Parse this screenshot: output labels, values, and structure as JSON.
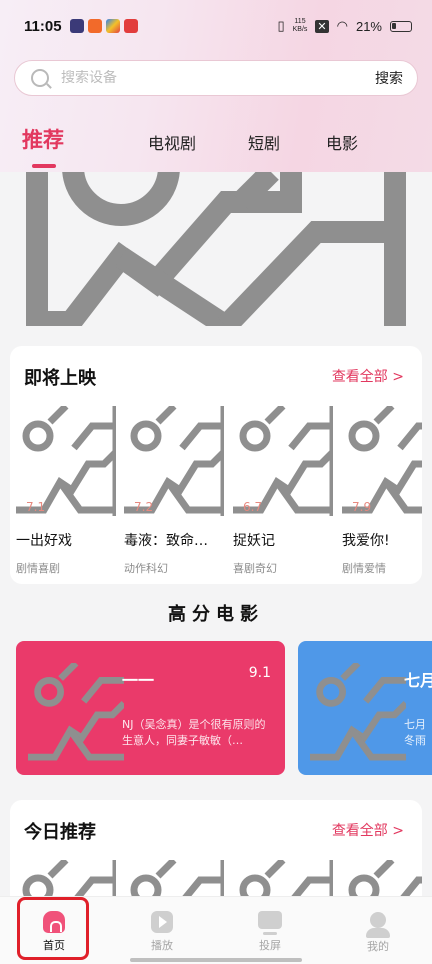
{
  "status_bar": {
    "time": "11:05",
    "net_speed_value": "115",
    "net_speed_unit": "KB/s",
    "battery": "21%"
  },
  "search": {
    "placeholder": "搜索设备",
    "button": "搜索"
  },
  "tabs": [
    {
      "label": "推荐",
      "active": true
    },
    {
      "label": "电视剧",
      "active": false
    },
    {
      "label": "短剧",
      "active": false
    },
    {
      "label": "电影",
      "active": false
    }
  ],
  "upcoming": {
    "title": "即将上映",
    "see_all": "查看全部 >",
    "items": [
      {
        "name": "一出好戏",
        "rating": "7.1",
        "genre": "剧情喜剧"
      },
      {
        "name": "毒液：致命…",
        "rating": "7.2",
        "genre": "动作科幻"
      },
      {
        "name": "捉妖记",
        "rating": "6.7",
        "genre": "喜剧奇幻"
      },
      {
        "name": "我爱你!",
        "rating": "7.9",
        "genre": "剧情爱情"
      }
    ]
  },
  "high_score": {
    "title": "高分电影",
    "cards": [
      {
        "name": "一一",
        "score": "9.1",
        "desc": "NJ（吴念真）是个很有原则的生意人，同妻子敏敏（…"
      },
      {
        "name": "七月",
        "desc_line1": "七月",
        "desc_line2": "冬雨"
      }
    ]
  },
  "today": {
    "title": "今日推荐",
    "see_all": "查看全部 >"
  },
  "bottom_nav": [
    {
      "label": "首页",
      "icon": "home-icon",
      "active": true
    },
    {
      "label": "播放",
      "icon": "play-icon",
      "active": false
    },
    {
      "label": "投屏",
      "icon": "screen-cast-icon",
      "active": false
    },
    {
      "label": "我的",
      "icon": "profile-icon",
      "active": false
    }
  ],
  "colors": {
    "accent": "#e2385f",
    "card_red": "#ea3a6a",
    "card_blue": "#4f98e8"
  }
}
